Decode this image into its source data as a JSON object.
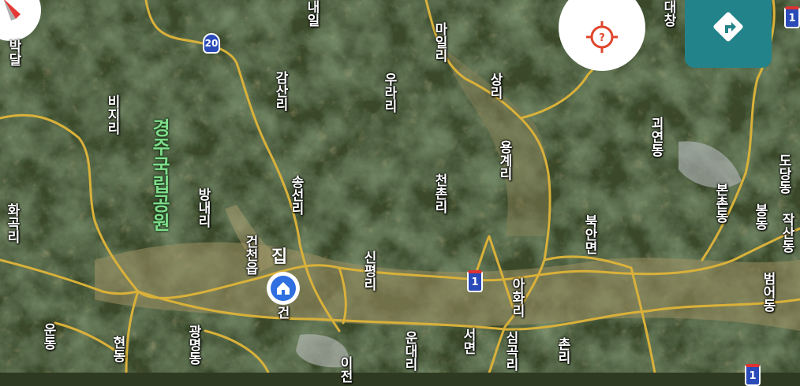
{
  "map": {
    "park_label": "경주국립공원",
    "home_label": "집",
    "route_shields": [
      "20",
      "1",
      "1",
      "1"
    ],
    "place_labels": {
      "naeil": "내일",
      "bakdal": "박달",
      "bijiri": "비지리",
      "hwagok": "화곡리",
      "bangnae": "방내리",
      "gamsan": "감산리",
      "urari": "우라리",
      "maeil": "마일리",
      "sangri": "상리",
      "songseon": "송선리",
      "geoncheon": "건천읍",
      "sinpyeong": "신평리",
      "cheonchon": "천촌리",
      "yonggye": "용계리",
      "gwaeyeon": "괴연동",
      "bonchon": "본촌동",
      "dodang": "도당동",
      "bongdong": "봉동",
      "jaksan": "작산동",
      "bukan": "북안면",
      "ahwa": "아화리",
      "beomeo": "범어동",
      "undong": "운동",
      "hyeondong": "현동",
      "gwangmyeong": "광명동",
      "undae": "운대리",
      "seomyeon": "서면",
      "simgok": "심곡리",
      "ijeon": "이전",
      "geonna": "건",
      "daechang": "대창",
      "chon": "촌리"
    }
  },
  "controls": {
    "locate_icon": "crosshair-question-icon",
    "share_icon": "route-share-icon",
    "compass_icon": "compass-needle-icon",
    "home_icon": "home-icon"
  },
  "colors": {
    "road": "#d9b13a",
    "share_button": "#23838a",
    "shield": "#2a4bb8",
    "park_text": "#7fdc8a",
    "locate_icon": "#e0452c"
  }
}
